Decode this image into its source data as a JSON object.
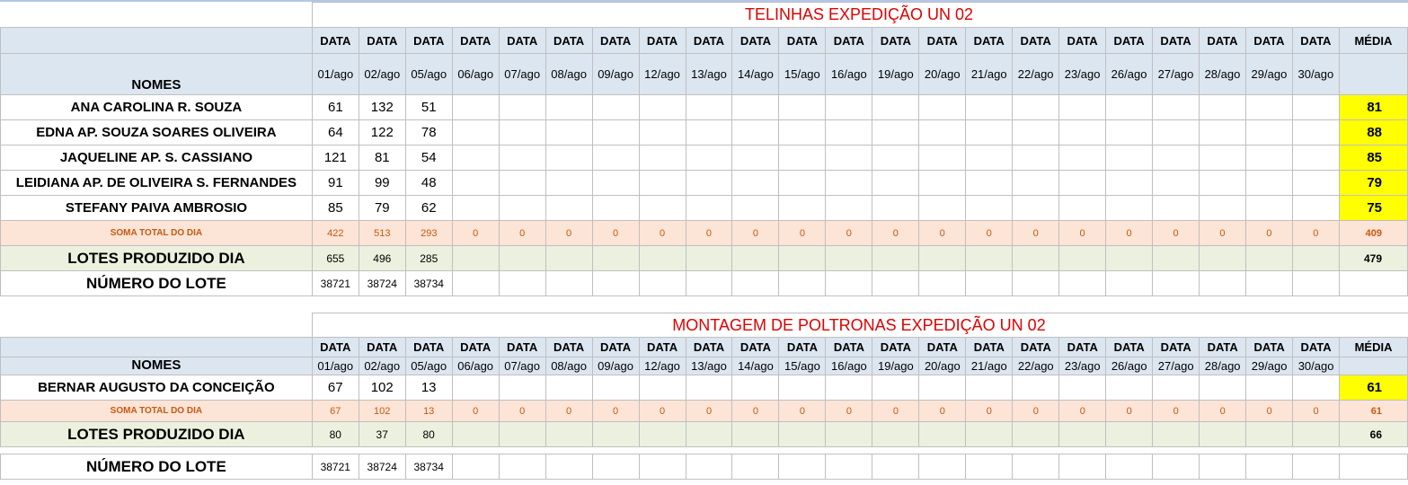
{
  "section1": {
    "title": "TELINHAS EXPEDIÇÃO UN 02",
    "data_label": "DATA",
    "media_label": "MÉDIA",
    "nomes_label": "NOMES",
    "dates": [
      "01/ago",
      "02/ago",
      "05/ago",
      "06/ago",
      "07/ago",
      "08/ago",
      "09/ago",
      "12/ago",
      "13/ago",
      "14/ago",
      "15/ago",
      "16/ago",
      "19/ago",
      "20/ago",
      "21/ago",
      "22/ago",
      "23/ago",
      "26/ago",
      "27/ago",
      "28/ago",
      "29/ago",
      "30/ago"
    ],
    "people": [
      {
        "name": "ANA CAROLINA R. SOUZA",
        "values": [
          "61",
          "132",
          "51"
        ],
        "media": "81"
      },
      {
        "name": "EDNA AP. SOUZA SOARES OLIVEIRA",
        "values": [
          "64",
          "122",
          "78"
        ],
        "media": "88"
      },
      {
        "name": "JAQUELINE AP.  S. CASSIANO",
        "values": [
          "121",
          "81",
          "54"
        ],
        "media": "85"
      },
      {
        "name": "LEIDIANA AP. DE OLIVEIRA S. FERNANDES",
        "values": [
          "91",
          "99",
          "48"
        ],
        "media": "79"
      },
      {
        "name": "STEFANY PAIVA AMBROSIO",
        "values": [
          "85",
          "79",
          "62"
        ],
        "media": "75"
      }
    ],
    "soma": {
      "label": "SOMA TOTAL DO DIA",
      "values": [
        "422",
        "513",
        "293",
        "0",
        "0",
        "0",
        "0",
        "0",
        "0",
        "0",
        "0",
        "0",
        "0",
        "0",
        "0",
        "0",
        "0",
        "0",
        "0",
        "0",
        "0",
        "0"
      ],
      "media": "409"
    },
    "lotes": {
      "label": "LOTES PRODUZIDO DIA",
      "values": [
        "655",
        "496",
        "285"
      ],
      "media": "479"
    },
    "numero_lote": {
      "label": "NÚMERO DO LOTE",
      "values": [
        "38721",
        "38724",
        "38734"
      ]
    }
  },
  "section2": {
    "title": "MONTAGEM DE POLTRONAS EXPEDIÇÃO UN 02",
    "data_label": "DATA",
    "media_label": "MÉDIA",
    "nomes_label": "NOMES",
    "dates": [
      "01/ago",
      "02/ago",
      "05/ago",
      "06/ago",
      "07/ago",
      "08/ago",
      "09/ago",
      "12/ago",
      "13/ago",
      "14/ago",
      "15/ago",
      "16/ago",
      "19/ago",
      "20/ago",
      "21/ago",
      "22/ago",
      "23/ago",
      "26/ago",
      "27/ago",
      "28/ago",
      "29/ago",
      "30/ago"
    ],
    "people": [
      {
        "name": "BERNAR AUGUSTO DA CONCEIÇÃO",
        "values": [
          "67",
          "102",
          "13"
        ],
        "media": "61"
      }
    ],
    "soma": {
      "label": "SOMA TOTAL DO DIA",
      "values": [
        "67",
        "102",
        "13",
        "0",
        "0",
        "0",
        "0",
        "0",
        "0",
        "0",
        "0",
        "0",
        "0",
        "0",
        "0",
        "0",
        "0",
        "0",
        "0",
        "0",
        "0",
        "0"
      ],
      "media": "61"
    },
    "lotes": {
      "label": "LOTES PRODUZIDO DIA",
      "values": [
        "80",
        "37",
        "80"
      ],
      "media": "66"
    },
    "numero_lote": {
      "label": "NÚMERO DO LOTE",
      "values": [
        "38721",
        "38724",
        "38734"
      ]
    }
  }
}
